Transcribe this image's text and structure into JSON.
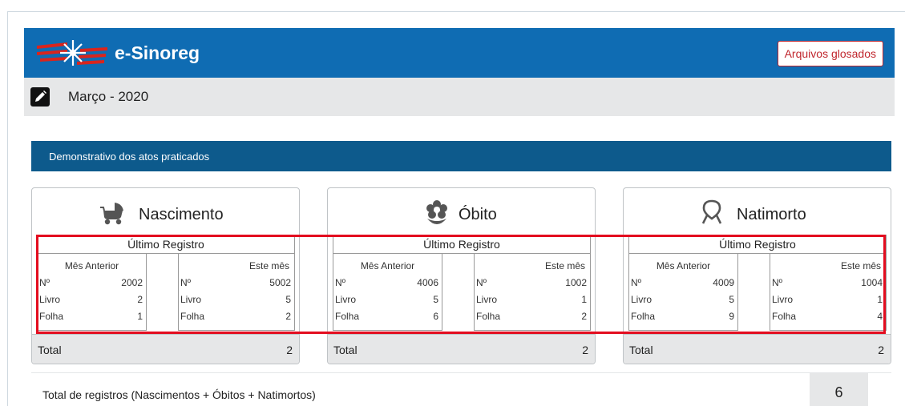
{
  "header": {
    "brand": "e-Sinoreg",
    "button_label": "Arquivos glosados",
    "accent": "#0f6cb3"
  },
  "month": {
    "title": "Março - 2020"
  },
  "section": {
    "title": "Demonstrativo dos atos praticados"
  },
  "cards": [
    {
      "title": "Nascimento",
      "icon": "baby-stroller-icon",
      "registro_title": "Último Registro",
      "mes_anterior": {
        "label": "Mês Anterior",
        "no_label": "Nº",
        "no": "2002",
        "livro_label": "Livro",
        "livro": "2",
        "folha_label": "Folha",
        "folha": "1"
      },
      "este_mes": {
        "label": "Este mês",
        "no_label": "Nº",
        "no": "5002",
        "livro_label": "Livro",
        "livro": "5",
        "folha_label": "Folha",
        "folha": "2"
      },
      "total_label": "Total",
      "total": "2"
    },
    {
      "title": "Óbito",
      "icon": "flower-icon",
      "registro_title": "Último Registro",
      "mes_anterior": {
        "label": "Mês Anterior",
        "no_label": "Nº",
        "no": "4006",
        "livro_label": "Livro",
        "livro": "5",
        "folha_label": "Folha",
        "folha": "6"
      },
      "este_mes": {
        "label": "Este mês",
        "no_label": "Nº",
        "no": "1002",
        "livro_label": "Livro",
        "livro": "1",
        "folha_label": "Folha",
        "folha": "2"
      },
      "total_label": "Total",
      "total": "2"
    },
    {
      "title": "Natimorto",
      "icon": "ribbon-icon",
      "registro_title": "Último Registro",
      "mes_anterior": {
        "label": "Mês Anterior",
        "no_label": "Nº",
        "no": "4009",
        "livro_label": "Livro",
        "livro": "5",
        "folha_label": "Folha",
        "folha": "9"
      },
      "este_mes": {
        "label": "Este mês",
        "no_label": "Nº",
        "no": "1004",
        "livro_label": "Livro",
        "livro": "1",
        "folha_label": "Folha",
        "folha": "4"
      },
      "total_label": "Total",
      "total": "2"
    }
  ],
  "summary": {
    "label": "Total de registros (Nascimentos + Óbitos + Natimortos)",
    "value": "6"
  },
  "colors": {
    "highlight": "#e30d1f",
    "section_bar": "#0d5a8c"
  }
}
